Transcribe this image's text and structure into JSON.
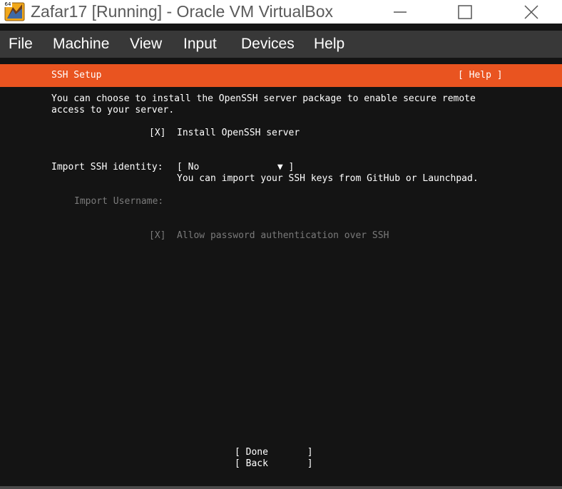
{
  "window": {
    "title": "Zafar17 [Running] - Oracle VM VirtualBox",
    "icon_badge": "64"
  },
  "menubar": {
    "items": [
      "File",
      "Machine",
      "View",
      "Input",
      "Devices",
      "Help"
    ]
  },
  "installer": {
    "header_title": "SSH Setup",
    "help_label": "[ Help ]",
    "intro_line1": "You can choose to install the OpenSSH server package to enable secure remote",
    "intro_line2": "access to your server.",
    "install_checkbox": "[X]",
    "install_label": "Install OpenSSH server",
    "identity_label": "Import SSH identity:",
    "identity_select": "[ No              ▼ ]",
    "identity_help": "You can import your SSH keys from GitHub or Launchpad.",
    "username_label": "Import Username:",
    "password_checkbox": "[X]",
    "password_label": "Allow password authentication over SSH",
    "done_label": "[ Done       ]",
    "back_label": "[ Back       ]"
  },
  "colors": {
    "accent": "#e95420",
    "menubar": "#383838",
    "screen_bg": "#141414",
    "dimmed_text": "#7a7a7a"
  }
}
